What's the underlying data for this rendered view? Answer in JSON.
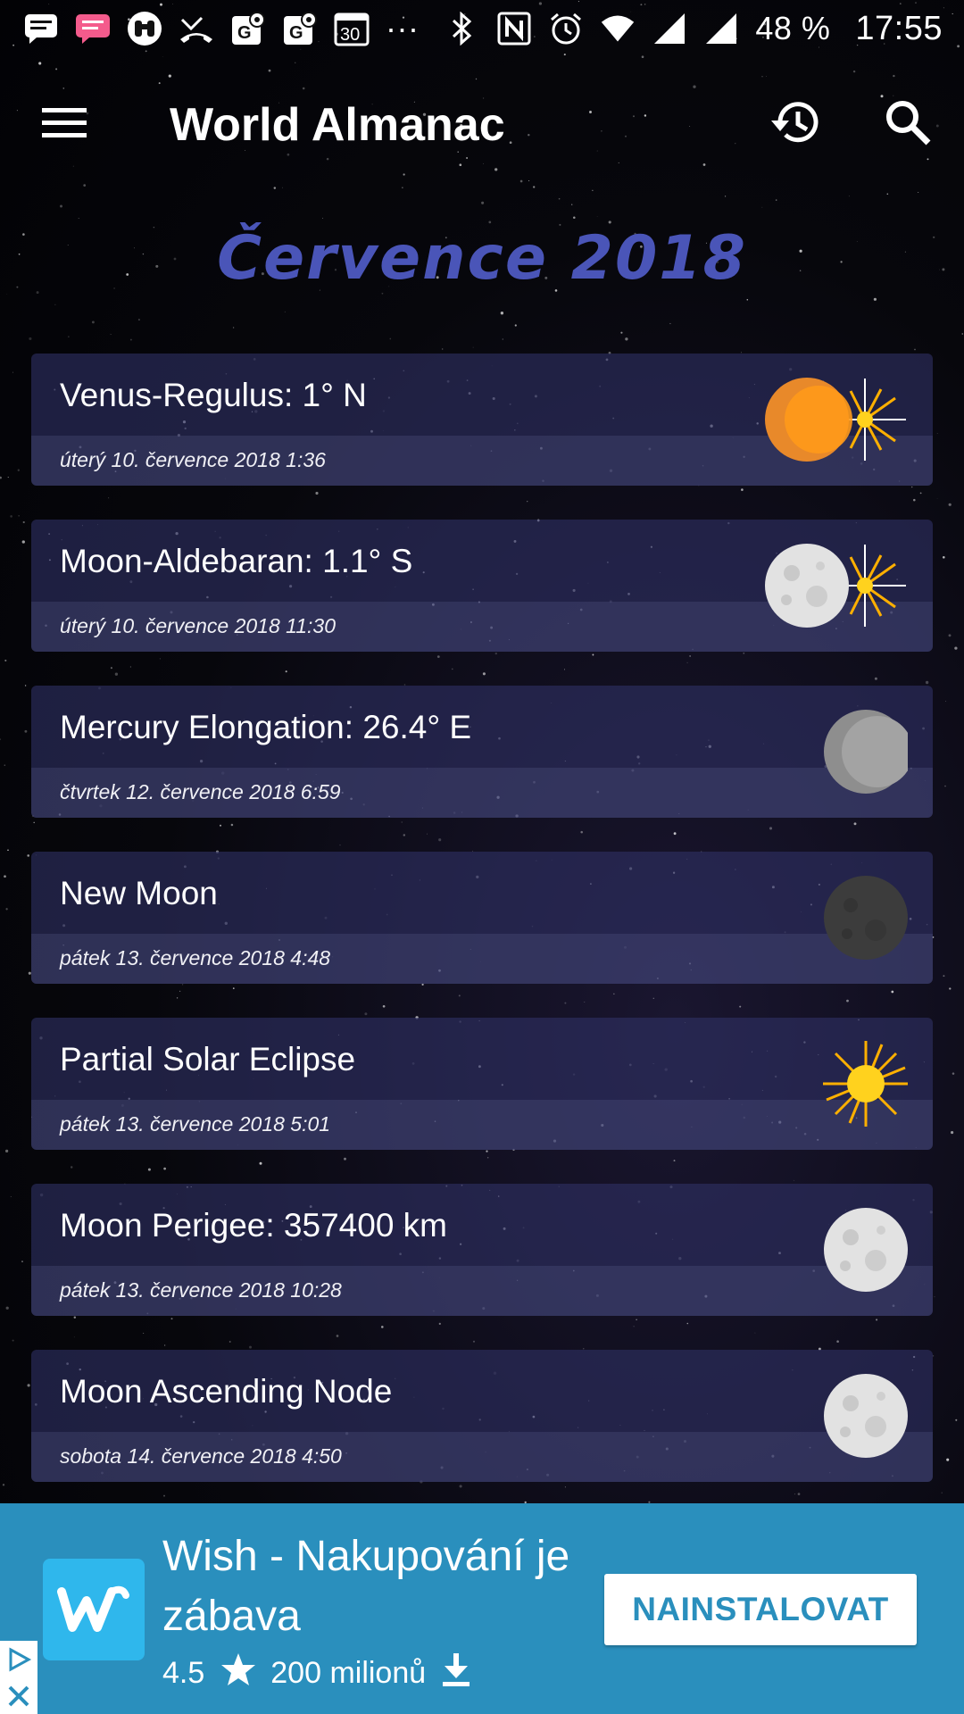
{
  "status_bar": {
    "icons": [
      "message-icon",
      "message-alt-icon",
      "binoculars-icon",
      "missed-call-icon",
      "maps-icon",
      "maps-alt-icon",
      "calendar-icon",
      "more-dots-icon",
      "bluetooth-icon",
      "nfc-icon",
      "alarm-icon",
      "wifi-icon",
      "signal-icon",
      "signal-alt-icon"
    ],
    "calendar_day": "30",
    "overflow": "···",
    "battery": "48 %",
    "time": "17:55"
  },
  "app_bar": {
    "title": "World Almanac",
    "menu_icon": "hamburger-menu-icon",
    "history_icon": "history-icon",
    "search_icon": "search-icon"
  },
  "month_title": "Července 2018",
  "events": [
    {
      "title": "Venus-Regulus: 1° N",
      "date": "úterý 10. července 2018 1:36",
      "icon": "venus-star-icon"
    },
    {
      "title": "Moon-Aldebaran: 1.1° S",
      "date": "úterý 10. července 2018 11:30",
      "icon": "moon-star-icon"
    },
    {
      "title": "Mercury Elongation: 26.4° E",
      "date": "čtvrtek 12. července 2018 6:59",
      "icon": "mercury-icon"
    },
    {
      "title": "New Moon",
      "date": "pátek 13. července 2018 4:48",
      "icon": "new-moon-icon"
    },
    {
      "title": "Partial Solar Eclipse",
      "date": "pátek 13. července 2018 5:01",
      "icon": "sun-icon"
    },
    {
      "title": "Moon Perigee: 357400 km",
      "date": "pátek 13. července 2018 10:28",
      "icon": "full-moon-icon"
    },
    {
      "title": "Moon Ascending Node",
      "date": "sobota 14. července 2018 4:50",
      "icon": "full-moon-icon"
    }
  ],
  "ad": {
    "title": "Wish - Nakupování je zábava",
    "rating": "4.5",
    "downloads": "200 milionů",
    "install_label": "NAINSTALOVAT",
    "brand_color": "#2fb7ec",
    "background_color": "#2a8fbd"
  },
  "colors": {
    "month_title": "#4a55b8",
    "card_bg": "#2e3064"
  }
}
